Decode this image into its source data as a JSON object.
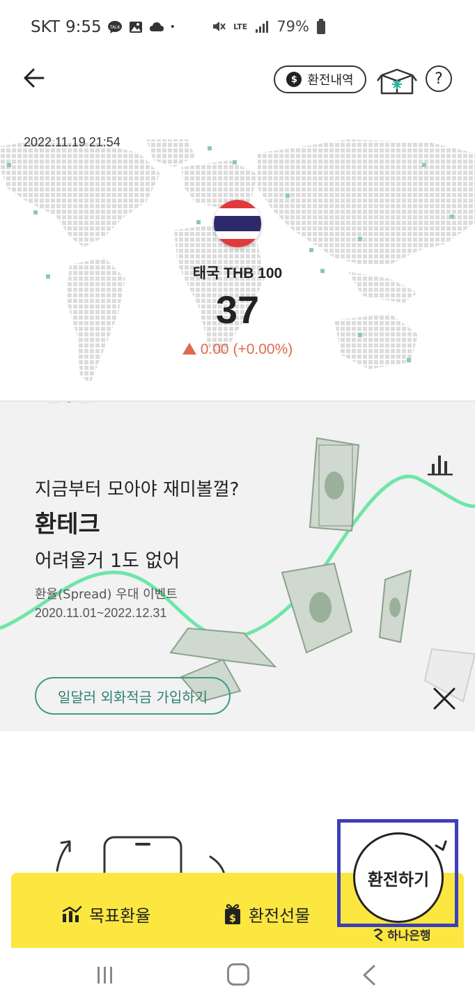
{
  "status_bar": {
    "carrier": "SKT",
    "time": "9:55",
    "talk_icon_label": "TALK",
    "network": "LTE",
    "battery": "79%"
  },
  "header": {
    "history_button": "환전내역",
    "help_button": "?"
  },
  "rate_card": {
    "timestamp": "2022.11.19 21:54",
    "currency": "태국 THB 100",
    "rate": "37",
    "change": "0.00 (+0.00%)",
    "change_color": "#e06a4d"
  },
  "banner": {
    "subtitle": "지금부터 모아야 재미볼껄?",
    "title": "환테크",
    "description": "어려울거 1도 없어",
    "event": "환율(Spread) 우대 이벤트",
    "period": "2020.11.01~2022.12.31",
    "cta": "일달러 외화적금 가입하기",
    "accent_color": "#3b9a8c"
  },
  "bottom_bar": {
    "target_rate": "목표환율",
    "gift": "환전선물",
    "exchange": "환전하기",
    "bank": "하나은행",
    "background": "#fbe740"
  }
}
